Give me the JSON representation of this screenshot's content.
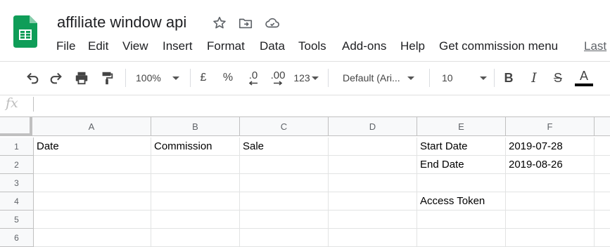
{
  "doc": {
    "title": "affiliate window api"
  },
  "icons": {
    "app": "google-sheets-logo",
    "star": "star-icon",
    "move": "move-to-folder-icon",
    "cloud": "cloud-saved-icon"
  },
  "menu": {
    "items": [
      "File",
      "Edit",
      "View",
      "Insert",
      "Format",
      "Data",
      "Tools",
      "Add-ons",
      "Help",
      "Get commission menu"
    ],
    "last_edit": "Last"
  },
  "toolbar": {
    "zoom": "100%",
    "currency": "£",
    "percent": "%",
    "dec_less": ".0",
    "dec_more": ".00",
    "format_more": "123",
    "font": "Default (Ari...",
    "font_size": "10",
    "bold": "B",
    "italic": "I",
    "strike": "S",
    "text_color": "A"
  },
  "formula_bar": {
    "fx": "fx",
    "value": ""
  },
  "columns": [
    "A",
    "B",
    "C",
    "D",
    "E",
    "F"
  ],
  "rows": [
    {
      "num": "1",
      "cells": [
        "Date",
        "Commission",
        "Sale",
        "",
        "Start Date",
        "2019-07-28"
      ]
    },
    {
      "num": "2",
      "cells": [
        "",
        "",
        "",
        "",
        "End Date",
        "2019-08-26"
      ]
    },
    {
      "num": "3",
      "cells": [
        "",
        "",
        "",
        "",
        "",
        ""
      ]
    },
    {
      "num": "4",
      "cells": [
        "",
        "",
        "",
        "",
        "Access Token",
        ""
      ]
    },
    {
      "num": "5",
      "cells": [
        "",
        "",
        "",
        "",
        "",
        ""
      ]
    },
    {
      "num": "6",
      "cells": [
        "",
        "",
        "",
        "",
        "",
        ""
      ]
    }
  ],
  "colors": {
    "sheets_green": "#0f9d58",
    "grid": "#e2e3e3",
    "header_bg": "#f8f9fa"
  }
}
